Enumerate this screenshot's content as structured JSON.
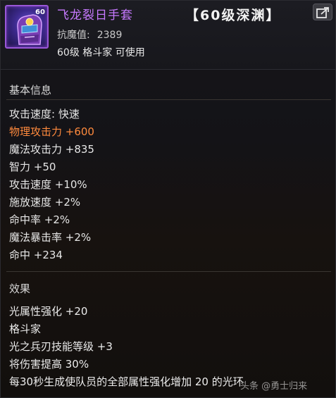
{
  "item": {
    "icon_name": "gauntlet-icon",
    "icon_level": "60",
    "name": "飞龙裂日手套",
    "tag": "【60级深渊】",
    "resist_label": "抗魔值:",
    "resist_value": "2389",
    "requirement": "60级 格斗家 可使用",
    "name_color": "#c779ff"
  },
  "basic": {
    "title": "基本信息",
    "stats": [
      "攻击速度: 快速",
      "物理攻击力 +600",
      "魔法攻击力 +835",
      "智力 +50",
      "攻击速度 +10%",
      "施放速度 +2%",
      "命中率 +2%",
      "魔法暴击率 +2%",
      "命中 +234"
    ],
    "highlight_color": "#ff8a3d"
  },
  "effects": {
    "title": "效果",
    "lines": [
      "光属性强化 +20",
      "格斗家",
      "光之兵刃技能等级 +3",
      "将伤害提高 30%",
      "每30秒生成使队员的全部属性强化增加 20 的光环"
    ]
  },
  "watermark": "头条 @勇士归来",
  "share_icon": "share-icon"
}
